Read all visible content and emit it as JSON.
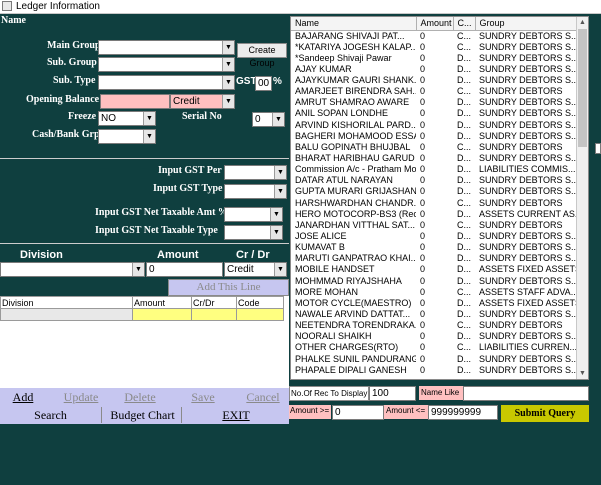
{
  "window": {
    "title": "Ledger Information"
  },
  "form": {
    "name_label": "Name",
    "main_group_label": "Main Group",
    "sub_group_label": "Sub. Group",
    "sub_type_label": "Sub. Type",
    "opening_balance_label": "Opening Balance",
    "opening_balance_crdr": "Credit",
    "freeze_label": "Freeze",
    "freeze_value": "NO",
    "serial_no_label": "Serial No",
    "serial_no_value": "0",
    "cash_bank_label": "Cash/Bank Grp",
    "create_group_label": "Create Group",
    "gst_label": "GST",
    "gst_value": "00",
    "gst_percent": "%"
  },
  "gst_inputs": {
    "gst_per_label": "Input GST Per",
    "gst_type_label": "Input GST Type",
    "net_taxable_amt_label": "Input GST Net Taxable Amt %",
    "net_taxable_type_label": "Input GST Net  Taxable Type"
  },
  "division_entry": {
    "division_label": "Division",
    "amount_label": "Amount",
    "crdr_label": "Cr / Dr",
    "amount_value": "0",
    "crdr_value": "Credit",
    "add_line_label": "Add This Line"
  },
  "division_grid": {
    "columns": [
      "Division",
      "Amount",
      "Cr/Dr",
      "Code"
    ]
  },
  "buttons": {
    "add": "Add",
    "update": "Update",
    "delete": "Delete",
    "save": "Save",
    "cancel": "Cancel",
    "search": "Search",
    "budget_chart": "Budget Chart",
    "exit": "EXIT",
    "submit_query": "Submit Query"
  },
  "ledger_list": {
    "columns": [
      "Name",
      "Amount",
      "C...",
      "Group"
    ],
    "rows": [
      [
        "BAJARANG SHIVAJI PAT...",
        "0",
        "C...",
        "SUNDRY DEBTORS S..."
      ],
      [
        "*KATARIYA JOGESH KALAP...",
        "0",
        "C...",
        "SUNDRY DEBTORS S..."
      ],
      [
        "*Sandeep Shivaji  Pawar",
        "0",
        "D...",
        "SUNDRY DEBTORS S..."
      ],
      [
        "AJAY KUMAR",
        "0",
        "D...",
        "SUNDRY DEBTORS S..."
      ],
      [
        "AJAYKUMAR GAURI SHANK...",
        "0",
        "D...",
        "SUNDRY DEBTORS S..."
      ],
      [
        "AMARJEET BIRENDRA SAH...",
        "0",
        "C...",
        "SUNDRY DEBTORS"
      ],
      [
        "AMRUT SHAMRAO AWARE",
        "0",
        "D...",
        "SUNDRY DEBTORS S..."
      ],
      [
        "ANIL SOPAN LONDHE",
        "0",
        "D...",
        "SUNDRY DEBTORS S..."
      ],
      [
        "ARVIND KISHORILAL  PARD...",
        "0",
        "D...",
        "SUNDRY DEBTORS S..."
      ],
      [
        "BAGHERI MOHAMOOD ESSA",
        "0",
        "D...",
        "SUNDRY DEBTORS S..."
      ],
      [
        "BALU GOPINATH BHUJBAL",
        "0",
        "C...",
        "SUNDRY DEBTORS"
      ],
      [
        "BHARAT HARIBHAU GARUD",
        "0",
        "D...",
        "SUNDRY DEBTORS S..."
      ],
      [
        "Commission A/c - Pratham Mot...",
        "0",
        "D...",
        "LIABILITIES COMMIS..."
      ],
      [
        "DATAR ATUL NARAYAN",
        "0",
        "D...",
        "SUNDRY DEBTORS S..."
      ],
      [
        "GUPTA MURARI GRIJASHAN...",
        "0",
        "D...",
        "SUNDRY DEBTORS S..."
      ],
      [
        "HARSHWARDHAN CHANDR...",
        "0",
        "C...",
        "SUNDRY DEBTORS"
      ],
      [
        "HERO MOTOCORP-BS3 (Rece...",
        "0",
        "D...",
        "ASSETS CURRENT AS..."
      ],
      [
        "JANARDHAN VITTHAL SAT...",
        "0",
        "C...",
        "SUNDRY DEBTORS"
      ],
      [
        "JOSE ALICE",
        "0",
        "D...",
        "SUNDRY DEBTORS S..."
      ],
      [
        "KUMAVAT B",
        "0",
        "D...",
        "SUNDRY DEBTORS S..."
      ],
      [
        "MARUTI GANPATRAO KHAI...",
        "0",
        "D...",
        "SUNDRY DEBTORS S..."
      ],
      [
        "MOBILE HANDSET",
        "0",
        "D...",
        "ASSETS FIXED ASSETS"
      ],
      [
        "MOHMMAD RIYAJSHAHA",
        "0",
        "D...",
        "SUNDRY DEBTORS S..."
      ],
      [
        "MORE MOHAN",
        "0",
        "C...",
        "ASSETS STAFF ADVA..."
      ],
      [
        "MOTOR CYCLE(MAESTRO)",
        "0",
        "D...",
        "ASSETS FIXED ASSETS"
      ],
      [
        "NAWALE ARVIND DATTAT...",
        "0",
        "D...",
        "SUNDRY DEBTORS S..."
      ],
      [
        "NEETENDRA TORENDRAKA...",
        "0",
        "C...",
        "SUNDRY DEBTORS"
      ],
      [
        "NOORALI SHAIKH",
        "0",
        "D...",
        "SUNDRY DEBTORS S..."
      ],
      [
        "OTHER CHARGES(RTO)",
        "0",
        "C...",
        "LIABILITIES CURREN..."
      ],
      [
        "PHALKE SUNIL PANDURANG",
        "0",
        "D...",
        "SUNDRY DEBTORS S..."
      ],
      [
        "PHAPALE DIPALI GANESH",
        "0",
        "D...",
        "SUNDRY DEBTORS S..."
      ]
    ]
  },
  "query": {
    "records_label": "No.Of Rec To Display",
    "records_value": "100",
    "name_like_label": "Name Like",
    "amount_gte_label": "Amount >=",
    "amount_gte_value": "0",
    "amount_lte_label": "Amount <=",
    "amount_lte_value": "999999999"
  }
}
